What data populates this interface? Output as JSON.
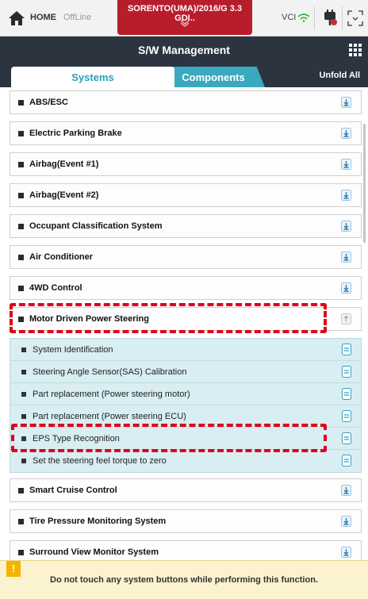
{
  "topbar": {
    "home_label": "HOME",
    "status_label": "OffLine",
    "vehicle_title": "SORENTO(UMA)/2016/G 3.3 GDI..",
    "vci_label": "VCI",
    "icons": [
      "home-icon",
      "chevron-down-icon",
      "wifi-icon",
      "plug-icon",
      "capture-icon"
    ]
  },
  "header": {
    "title": "S/W Management",
    "menu_icon": "grid-icon"
  },
  "tabs": [
    {
      "label": "Systems",
      "active": true
    },
    {
      "label": "Components",
      "active": false
    }
  ],
  "unfold_label": "Unfold All",
  "systems": [
    {
      "label": "ABS/ESC"
    },
    {
      "label": "Electric Parking Brake"
    },
    {
      "label": "Airbag(Event #1)"
    },
    {
      "label": "Airbag(Event #2)"
    },
    {
      "label": "Occupant Classification System"
    },
    {
      "label": "Air Conditioner"
    },
    {
      "label": "4WD Control"
    },
    {
      "label": "Motor Driven Power Steering",
      "expanded": true
    }
  ],
  "functions": [
    {
      "label": "System Identification"
    },
    {
      "label": "Steering Angle Sensor(SAS) Calibration"
    },
    {
      "label": "Part replacement (Power steering motor)"
    },
    {
      "label": "Part replacement (Power steering ECU)"
    },
    {
      "label": "EPS Type Recognition"
    },
    {
      "label": "Set the steering feel torque to zero"
    }
  ],
  "systems_after": [
    {
      "label": "Smart Cruise Control"
    },
    {
      "label": "Tire Pressure Monitoring System"
    },
    {
      "label": "Surround View Monitor System"
    }
  ],
  "warning": {
    "icon_text": "!",
    "text": "Do not touch any system buttons while performing this function."
  },
  "colors": {
    "accent": "#3aa9bf",
    "vehicle_bar": "#b81d2c",
    "header_bg": "#2c3440",
    "highlight": "#e0001b",
    "sub_bg": "#d8eef2",
    "warning_bg": "#fbf3cf"
  }
}
